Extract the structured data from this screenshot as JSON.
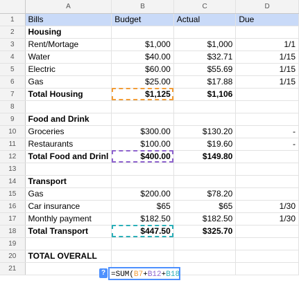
{
  "columns": [
    "A",
    "B",
    "C",
    "D"
  ],
  "rows": [
    {
      "n": "1",
      "cells": [
        "Bills",
        "Budget",
        "Actual",
        "Due"
      ]
    },
    {
      "n": "2",
      "cells": [
        "Housing",
        "",
        "",
        ""
      ]
    },
    {
      "n": "3",
      "cells": [
        "Rent/Mortage",
        "$1,000",
        "$1,000",
        "1/1"
      ]
    },
    {
      "n": "4",
      "cells": [
        "Water",
        "$40.00",
        "$32.71",
        "1/15"
      ]
    },
    {
      "n": "5",
      "cells": [
        "Electric",
        "$60.00",
        "$55.69",
        "1/15"
      ]
    },
    {
      "n": "6",
      "cells": [
        "Gas",
        "$25.00",
        "$17.88",
        "1/15"
      ]
    },
    {
      "n": "7",
      "cells": [
        "Total Housing",
        "$1,125",
        "$1,106",
        ""
      ]
    },
    {
      "n": "8",
      "cells": [
        "",
        "",
        "",
        ""
      ]
    },
    {
      "n": "9",
      "cells": [
        "Food and Drink",
        "",
        "",
        ""
      ]
    },
    {
      "n": "10",
      "cells": [
        "Groceries",
        "$300.00",
        "$130.20",
        "-"
      ]
    },
    {
      "n": "11",
      "cells": [
        "Restaurants",
        "$100.00",
        "$19.60",
        "-"
      ]
    },
    {
      "n": "12",
      "cells": [
        "Total Food and Drinl",
        "$400.00",
        "$149.80",
        ""
      ]
    },
    {
      "n": "13",
      "cells": [
        "",
        "",
        "",
        ""
      ]
    },
    {
      "n": "14",
      "cells": [
        "Transport",
        "",
        "",
        ""
      ]
    },
    {
      "n": "15",
      "cells": [
        "Gas",
        "$200.00",
        "$78.20",
        ""
      ]
    },
    {
      "n": "16",
      "cells": [
        "Car insurance",
        "$65",
        "$65",
        "1/30"
      ]
    },
    {
      "n": "17",
      "cells": [
        "Monthly payment",
        "$182.50",
        "$182.50",
        "1/30"
      ]
    },
    {
      "n": "18",
      "cells": [
        "Total Transport",
        "$447.50",
        "$325.70",
        ""
      ]
    },
    {
      "n": "19",
      "cells": [
        "",
        "",
        "",
        ""
      ]
    },
    {
      "n": "20",
      "cells": [
        "TOTAL OVERALL",
        "",
        "",
        ""
      ]
    },
    {
      "n": "21",
      "cells": [
        "",
        "",
        "",
        ""
      ]
    }
  ],
  "editor": {
    "help": "?",
    "prefix": "=SUM(",
    "ref1": "B7",
    "plus1": "+",
    "ref2": "B12",
    "plus2": "+",
    "ref3": "B18",
    "suffix": ")"
  },
  "colors": {
    "header_fill": "#c9daf8",
    "ref_orange": "#f29d38",
    "ref_purple": "#8e63ce",
    "ref_teal": "#2bafb8",
    "editor_border": "#4d90fe"
  }
}
